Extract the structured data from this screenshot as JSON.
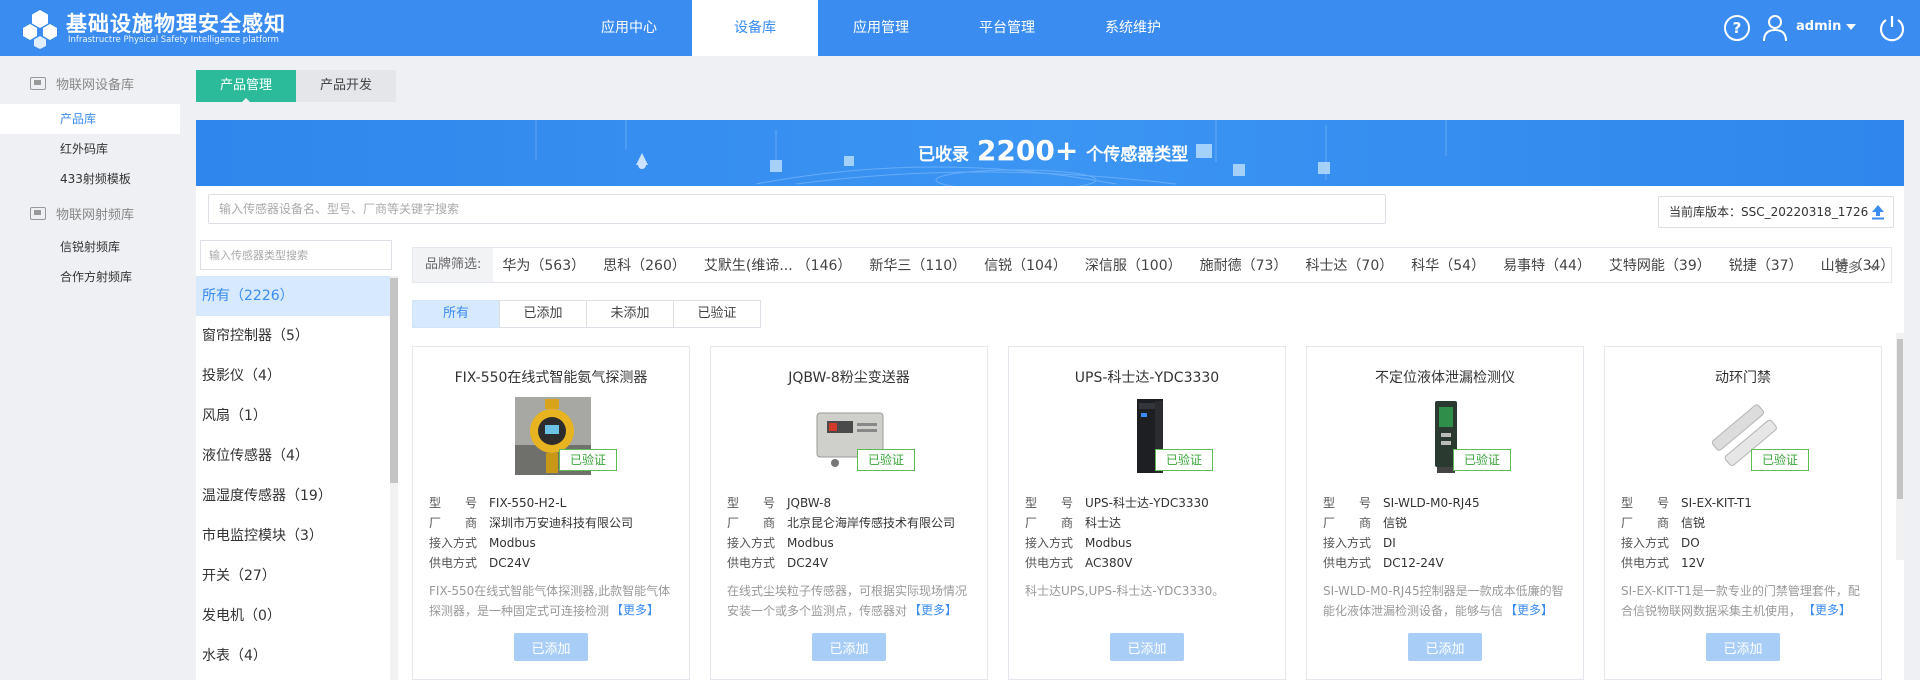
{
  "header": {
    "title": "基础设施物理安全感知",
    "subtitle": "Infrastructre Physical Safety Intelligence platform",
    "nav": [
      "应用中心",
      "设备库",
      "应用管理",
      "平台管理",
      "系统维护"
    ],
    "active_nav": "设备库",
    "user": "admin",
    "help_label": "?"
  },
  "sidebar": {
    "groups": [
      {
        "label": "物联网设备库",
        "items": [
          "产品库",
          "红外码库",
          "433射频模板"
        ]
      },
      {
        "label": "物联网射频库",
        "items": [
          "信锐射频库",
          "合作方射频库"
        ]
      }
    ],
    "active_item": "产品库"
  },
  "subtabs": [
    "产品管理",
    "产品开发"
  ],
  "banner": {
    "prefix": "已收录",
    "count": "2200+",
    "suffix": "个传感器类型"
  },
  "search": {
    "placeholder": "输入传感器设备名、型号、厂商等关键字搜索",
    "value": ""
  },
  "version": {
    "label": "当前库版本：SSC_20220318_1726"
  },
  "category_search": {
    "placeholder": "输入传感器类型搜索"
  },
  "categories": [
    "所有（2226）",
    "窗帘控制器（5）",
    "投影仪（4）",
    "风扇（1）",
    "液位传感器（4）",
    "温湿度传感器（19）",
    "市电监控模块（3）",
    "开关（27）",
    "发电机（0）",
    "水表（4）"
  ],
  "brand_filter": {
    "label": "品牌筛选:",
    "brands": [
      "华为（563）",
      "思科（260）",
      "艾默生(维谛...",
      "（146）",
      "新华三（110）",
      "信锐（104）",
      "深信服（100）",
      "施耐德（73）",
      "科士达（70）",
      "科华（54）",
      "易事特（44）",
      "艾特网能（39）",
      "锐捷（37）",
      "山特（34）"
    ],
    "more_label": "更多"
  },
  "status_tabs": [
    "所有",
    "已添加",
    "未添加",
    "已验证"
  ],
  "spec_labels": {
    "model": "型　　号",
    "vendor": "厂　　商",
    "access": "接入方式",
    "power": "供电方式"
  },
  "verified_label": "已验证",
  "more_link": "【更多】",
  "added_button": "已添加",
  "products": [
    {
      "name": "FIX-550在线式智能氨气探测器",
      "model": "FIX-550-H2-L",
      "vendor": "深圳市万安迪科技有限公司",
      "access": "Modbus",
      "power": "DC24V",
      "desc": "FIX-550在线式智能气体探测器,此款智能气体探测器，是一种固定式可连接检测",
      "image_icon": "gas-detector-icon"
    },
    {
      "name": "JQBW-8粉尘变送器",
      "model": "JQBW-8",
      "vendor": "北京昆仑海岸传感技术有限公司",
      "access": "Modbus",
      "power": "DC24V",
      "desc": "在线式尘埃粒子传感器，可根据实际现场情况安装一个或多个监测点，传感器对",
      "image_icon": "dust-transmitter-icon"
    },
    {
      "name": "UPS-科士达-YDC3330",
      "model": "UPS-科士达-YDC3330",
      "vendor": "科士达",
      "access": "Modbus",
      "power": "AC380V",
      "desc": "科士达UPS,UPS-科士达-YDC3330。",
      "image_icon": "ups-cabinet-icon"
    },
    {
      "name": "不定位液体泄漏检测仪",
      "model": "SI-WLD-M0-RJ45",
      "vendor": "信锐",
      "access": "DI",
      "power": "DC12-24V",
      "desc": "SI-WLD-M0-RJ45控制器是一款成本低廉的智能化液体泄漏检测设备，能够与信锐",
      "image_icon": "leak-detector-icon"
    },
    {
      "name": "动环门禁",
      "model": "SI-EX-KIT-T1",
      "vendor": "信锐",
      "access": "DO",
      "power": "12V",
      "desc": "SI-EX-KIT-T1是一款专业的门禁管理套件，配合信锐物联网数据采集主机使用，",
      "image_icon": "door-sensor-icon"
    }
  ],
  "colors": {
    "primary": "#3a8cf0",
    "teal": "#2bbb9a",
    "verified": "#3aa33a",
    "button_disabled": "#a8cdf6"
  }
}
